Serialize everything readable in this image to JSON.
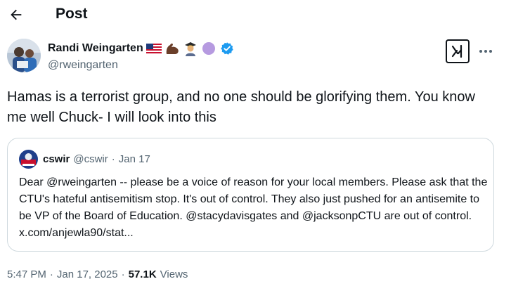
{
  "header": {
    "title": "Post",
    "back_icon": "arrow-left-icon"
  },
  "author": {
    "name": "Randi Weingarten",
    "handle": "@rweingarten",
    "emojis": [
      "us-flag-icon",
      "flexed-biceps-icon",
      "teacher-icon",
      "purple-circle-icon"
    ],
    "verified_icon": "verified-badge-icon",
    "verified_color": "#1d9bf0"
  },
  "actions": {
    "grok_icon": "grok-icon",
    "more_icon": "more-dots-icon"
  },
  "post": {
    "text": "Hamas is a terrorist group, and no one should be glorifying them. You know me well Chuck- I will look into this"
  },
  "quote": {
    "name": "cswir",
    "handle": "@cswir",
    "separator": "·",
    "date": "Jan 17",
    "text": "Dear @rweingarten -- please be a voice of reason for your local members. Please ask that the CTU's hateful antisemitism stop. It's out of control. They also just pushed for an antisemite to be VP of the Board of Education. @stacydavisgates and @jacksonpCTU are out of control. x.com/anjewla90/stat..."
  },
  "meta": {
    "time": "5:47 PM",
    "separator": "·",
    "date": "Jan 17, 2025",
    "separator2": "·",
    "views_count": "57.1K",
    "views_label": "Views"
  },
  "colors": {
    "text_primary": "#0f1419",
    "text_secondary": "#536471",
    "border": "#cfd9de",
    "accent": "#1d9bf0"
  }
}
